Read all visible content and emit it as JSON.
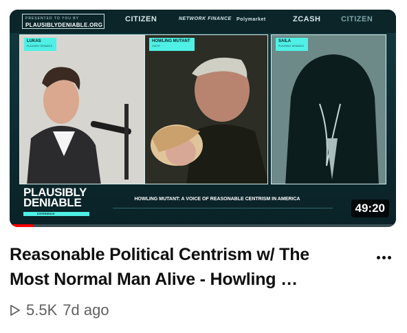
{
  "thumbnail": {
    "site_logo_small": "PRESENTED TO YOU BY",
    "site_logo": "PLAUSIBLYDENIABLE.ORG",
    "sponsors": [
      "CITIZEN",
      "NETWORK FINANCE",
      "Polymarket",
      "ZCASH",
      "CITIZEN"
    ],
    "panels": [
      {
        "name": "LUKAS",
        "sub": "PLAUSIBLY DENIABLE"
      },
      {
        "name": "HOWLING MUTANT",
        "sub": "GUEST"
      },
      {
        "name": "SAILA",
        "sub": "PLAUSIBLY DENIABLE"
      }
    ],
    "brand_line1": "PLAUSIBLY",
    "brand_line2": "DENIABLE",
    "brand_strip": "EXPERIENCE",
    "caption": "HOWLING MUTANT: A VOICE OF REASONABLE CENTRISM IN AMERICA",
    "duration": "49:20",
    "progress": 0.06,
    "progress_color": "#ff0000",
    "accent_color": "#4ff0e6"
  },
  "video": {
    "title": "Reasonable Political Centrism w/ The Most Normal Man Alive - Howling …",
    "views": "5.5K",
    "age": "7d ago"
  },
  "icons": {
    "more": "more-vertical-dots-icon",
    "views": "play-outline-icon"
  }
}
